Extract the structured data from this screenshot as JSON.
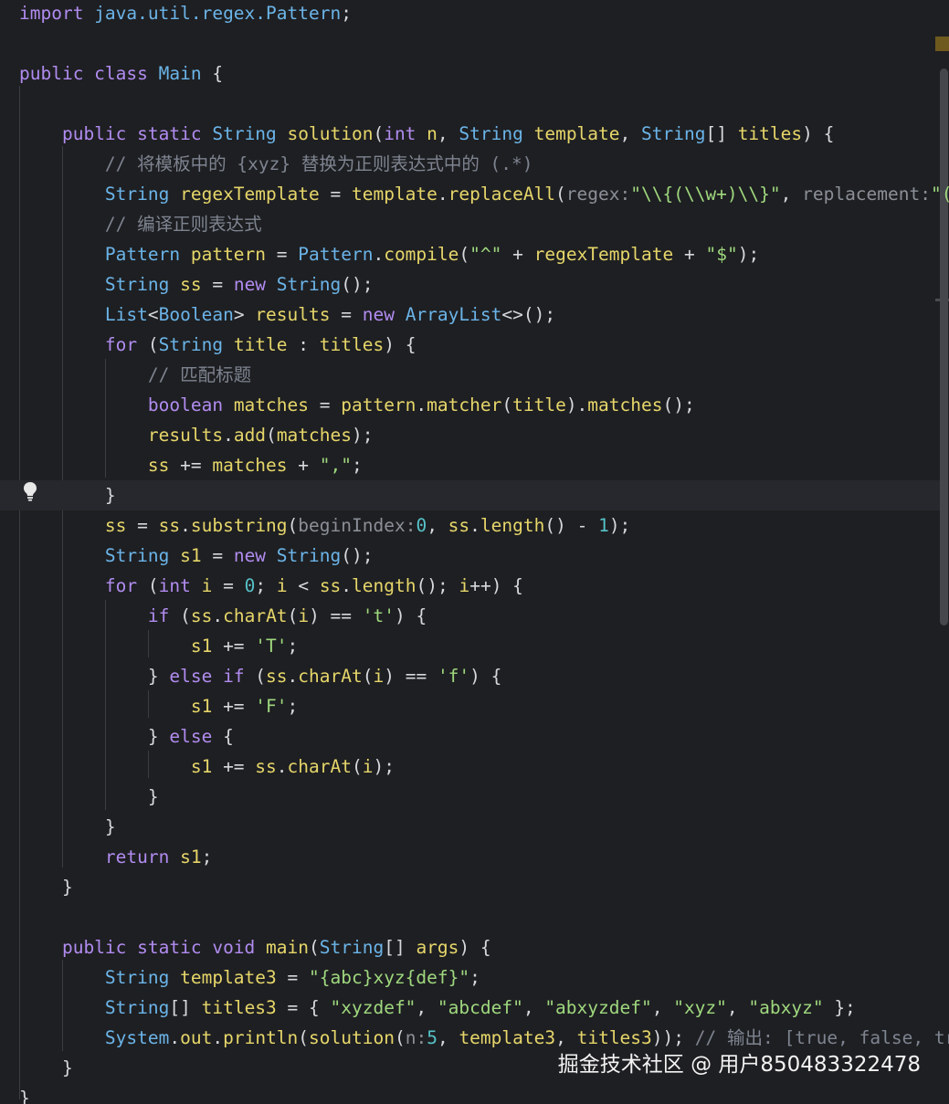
{
  "editor": {
    "language": "Java",
    "highlighted_line": 17,
    "lines": [
      [
        [
          "kw",
          "import "
        ],
        [
          "ty",
          "java.util.regex.Pattern"
        ],
        [
          "pl",
          ";"
        ]
      ],
      [],
      [
        [
          "kw",
          "public class "
        ],
        [
          "ty",
          "Main"
        ],
        [
          "pl",
          " {"
        ]
      ],
      [],
      [
        [
          "pl",
          "    "
        ],
        [
          "kw",
          "public static "
        ],
        [
          "ty",
          "String "
        ],
        [
          "fn",
          "solution"
        ],
        [
          "pl",
          "("
        ],
        [
          "kw",
          "int "
        ],
        [
          "va",
          "n"
        ],
        [
          "pl",
          ", "
        ],
        [
          "ty",
          "String "
        ],
        [
          "va",
          "template"
        ],
        [
          "pl",
          ", "
        ],
        [
          "ty",
          "String"
        ],
        [
          "pl",
          "[] "
        ],
        [
          "va",
          "titles"
        ],
        [
          "pl",
          ") {"
        ]
      ],
      [
        [
          "pl",
          "        "
        ],
        [
          "cm",
          "// 将模板中的 {xyz} 替换为正则表达式中的 (.*)"
        ]
      ],
      [
        [
          "pl",
          "        "
        ],
        [
          "ty",
          "String "
        ],
        [
          "va",
          "regexTemplate"
        ],
        [
          "pl",
          " = "
        ],
        [
          "va",
          "template"
        ],
        [
          "pl",
          "."
        ],
        [
          "fn",
          "replaceAll"
        ],
        [
          "pl",
          "("
        ],
        [
          "pm",
          "regex:"
        ],
        [
          "st",
          "\"\\\\{(\\\\w+)\\\\}\""
        ],
        [
          "pl",
          ", "
        ],
        [
          "pm",
          "replacement:"
        ],
        [
          "st",
          "\"(.*)\""
        ],
        [
          "pl",
          ");"
        ]
      ],
      [
        [
          "pl",
          "        "
        ],
        [
          "cm",
          "// 编译正则表达式"
        ]
      ],
      [
        [
          "pl",
          "        "
        ],
        [
          "ty",
          "Pattern "
        ],
        [
          "va",
          "pattern"
        ],
        [
          "pl",
          " = "
        ],
        [
          "ty",
          "Pattern"
        ],
        [
          "pl",
          "."
        ],
        [
          "fn",
          "compile"
        ],
        [
          "pl",
          "("
        ],
        [
          "st",
          "\"^\""
        ],
        [
          "pl",
          " + "
        ],
        [
          "va",
          "regexTemplate"
        ],
        [
          "pl",
          " + "
        ],
        [
          "st",
          "\"$\""
        ],
        [
          "pl",
          ");"
        ]
      ],
      [
        [
          "pl",
          "        "
        ],
        [
          "ty",
          "String "
        ],
        [
          "va",
          "ss"
        ],
        [
          "pl",
          " = "
        ],
        [
          "kw",
          "new "
        ],
        [
          "ty",
          "String"
        ],
        [
          "pl",
          "();"
        ]
      ],
      [
        [
          "pl",
          "        "
        ],
        [
          "ty",
          "List"
        ],
        [
          "pl",
          "<"
        ],
        [
          "ty",
          "Boolean"
        ],
        [
          "pl",
          "> "
        ],
        [
          "va",
          "results"
        ],
        [
          "pl",
          " = "
        ],
        [
          "kw",
          "new "
        ],
        [
          "ty",
          "ArrayList"
        ],
        [
          "pl",
          "<>();"
        ]
      ],
      [
        [
          "pl",
          "        "
        ],
        [
          "kw",
          "for "
        ],
        [
          "pl",
          "("
        ],
        [
          "ty",
          "String "
        ],
        [
          "va",
          "title"
        ],
        [
          "pl",
          " : "
        ],
        [
          "va",
          "titles"
        ],
        [
          "pl",
          ") {"
        ]
      ],
      [
        [
          "pl",
          "            "
        ],
        [
          "cm",
          "// 匹配标题"
        ]
      ],
      [
        [
          "pl",
          "            "
        ],
        [
          "kw",
          "boolean "
        ],
        [
          "va",
          "matches"
        ],
        [
          "pl",
          " = "
        ],
        [
          "va",
          "pattern"
        ],
        [
          "pl",
          "."
        ],
        [
          "fn",
          "matcher"
        ],
        [
          "pl",
          "("
        ],
        [
          "va",
          "title"
        ],
        [
          "pl",
          ")."
        ],
        [
          "fn",
          "matches"
        ],
        [
          "pl",
          "();"
        ]
      ],
      [
        [
          "pl",
          "            "
        ],
        [
          "va",
          "results"
        ],
        [
          "pl",
          "."
        ],
        [
          "fn",
          "add"
        ],
        [
          "pl",
          "("
        ],
        [
          "va",
          "matches"
        ],
        [
          "pl",
          ");"
        ]
      ],
      [
        [
          "pl",
          "            "
        ],
        [
          "va",
          "ss"
        ],
        [
          "pl",
          " += "
        ],
        [
          "va",
          "matches"
        ],
        [
          "pl",
          " + "
        ],
        [
          "st",
          "\",\""
        ],
        [
          "pl",
          ";"
        ]
      ],
      [
        [
          "pl",
          "        }"
        ]
      ],
      [
        [
          "pl",
          "        "
        ],
        [
          "va",
          "ss"
        ],
        [
          "pl",
          " = "
        ],
        [
          "va",
          "ss"
        ],
        [
          "pl",
          "."
        ],
        [
          "fn",
          "substring"
        ],
        [
          "pl",
          "("
        ],
        [
          "pm",
          "beginIndex:"
        ],
        [
          "nu",
          "0"
        ],
        [
          "pl",
          ", "
        ],
        [
          "va",
          "ss"
        ],
        [
          "pl",
          "."
        ],
        [
          "fn",
          "length"
        ],
        [
          "pl",
          "() - "
        ],
        [
          "nu",
          "1"
        ],
        [
          "pl",
          ");"
        ]
      ],
      [
        [
          "pl",
          "        "
        ],
        [
          "ty",
          "String "
        ],
        [
          "va",
          "s1"
        ],
        [
          "pl",
          " = "
        ],
        [
          "kw",
          "new "
        ],
        [
          "ty",
          "String"
        ],
        [
          "pl",
          "();"
        ]
      ],
      [
        [
          "pl",
          "        "
        ],
        [
          "kw",
          "for "
        ],
        [
          "pl",
          "("
        ],
        [
          "kw",
          "int "
        ],
        [
          "va",
          "i"
        ],
        [
          "pl",
          " = "
        ],
        [
          "nu",
          "0"
        ],
        [
          "pl",
          "; "
        ],
        [
          "va",
          "i"
        ],
        [
          "pl",
          " < "
        ],
        [
          "va",
          "ss"
        ],
        [
          "pl",
          "."
        ],
        [
          "fn",
          "length"
        ],
        [
          "pl",
          "(); "
        ],
        [
          "va",
          "i"
        ],
        [
          "pl",
          "++) {"
        ]
      ],
      [
        [
          "pl",
          "            "
        ],
        [
          "kw",
          "if "
        ],
        [
          "pl",
          "("
        ],
        [
          "va",
          "ss"
        ],
        [
          "pl",
          "."
        ],
        [
          "fn",
          "charAt"
        ],
        [
          "pl",
          "("
        ],
        [
          "va",
          "i"
        ],
        [
          "pl",
          ") == "
        ],
        [
          "st",
          "'t'"
        ],
        [
          "pl",
          ") {"
        ]
      ],
      [
        [
          "pl",
          "                "
        ],
        [
          "va",
          "s1"
        ],
        [
          "pl",
          " += "
        ],
        [
          "st",
          "'T'"
        ],
        [
          "pl",
          ";"
        ]
      ],
      [
        [
          "pl",
          "            } "
        ],
        [
          "kw",
          "else if "
        ],
        [
          "pl",
          "("
        ],
        [
          "va",
          "ss"
        ],
        [
          "pl",
          "."
        ],
        [
          "fn",
          "charAt"
        ],
        [
          "pl",
          "("
        ],
        [
          "va",
          "i"
        ],
        [
          "pl",
          ") == "
        ],
        [
          "st",
          "'f'"
        ],
        [
          "pl",
          ") {"
        ]
      ],
      [
        [
          "pl",
          "                "
        ],
        [
          "va",
          "s1"
        ],
        [
          "pl",
          " += "
        ],
        [
          "st",
          "'F'"
        ],
        [
          "pl",
          ";"
        ]
      ],
      [
        [
          "pl",
          "            } "
        ],
        [
          "kw",
          "else "
        ],
        [
          "pl",
          "{"
        ]
      ],
      [
        [
          "pl",
          "                "
        ],
        [
          "va",
          "s1"
        ],
        [
          "pl",
          " += "
        ],
        [
          "va",
          "ss"
        ],
        [
          "pl",
          "."
        ],
        [
          "fn",
          "charAt"
        ],
        [
          "pl",
          "("
        ],
        [
          "va",
          "i"
        ],
        [
          "pl",
          ");"
        ]
      ],
      [
        [
          "pl",
          "            }"
        ]
      ],
      [
        [
          "pl",
          "        }"
        ]
      ],
      [
        [
          "pl",
          "        "
        ],
        [
          "kw",
          "return "
        ],
        [
          "va",
          "s1"
        ],
        [
          "pl",
          ";"
        ]
      ],
      [
        [
          "pl",
          "    }"
        ]
      ],
      [],
      [
        [
          "pl",
          "    "
        ],
        [
          "kw",
          "public static void "
        ],
        [
          "fn",
          "main"
        ],
        [
          "pl",
          "("
        ],
        [
          "ty",
          "String"
        ],
        [
          "pl",
          "[] "
        ],
        [
          "va",
          "args"
        ],
        [
          "pl",
          ") {"
        ]
      ],
      [
        [
          "pl",
          "        "
        ],
        [
          "ty",
          "String "
        ],
        [
          "va",
          "template3"
        ],
        [
          "pl",
          " = "
        ],
        [
          "st",
          "\"{abc}xyz{def}\""
        ],
        [
          "pl",
          ";"
        ]
      ],
      [
        [
          "pl",
          "        "
        ],
        [
          "ty",
          "String"
        ],
        [
          "pl",
          "[] "
        ],
        [
          "va",
          "titles3"
        ],
        [
          "pl",
          " = { "
        ],
        [
          "st",
          "\"xyzdef\""
        ],
        [
          "pl",
          ", "
        ],
        [
          "st",
          "\"abcdef\""
        ],
        [
          "pl",
          ", "
        ],
        [
          "st",
          "\"abxyzdef\""
        ],
        [
          "pl",
          ", "
        ],
        [
          "st",
          "\"xyz\""
        ],
        [
          "pl",
          ", "
        ],
        [
          "st",
          "\"abxyz\""
        ],
        [
          "pl",
          " };"
        ]
      ],
      [
        [
          "pl",
          "        "
        ],
        [
          "ty",
          "System"
        ],
        [
          "pl",
          "."
        ],
        [
          "va",
          "out"
        ],
        [
          "pl",
          "."
        ],
        [
          "fn",
          "println"
        ],
        [
          "pl",
          "("
        ],
        [
          "fn",
          "solution"
        ],
        [
          "pl",
          "("
        ],
        [
          "pm",
          "n:"
        ],
        [
          "nu",
          "5"
        ],
        [
          "pl",
          ", "
        ],
        [
          "va",
          "template3"
        ],
        [
          "pl",
          ", "
        ],
        [
          "va",
          "titles3"
        ],
        [
          "pl",
          "));"
        ],
        [
          "cm",
          " // 输出: [true, false, true, false, false]"
        ]
      ],
      [
        [
          "pl",
          "    }"
        ]
      ],
      [
        [
          "pl",
          "}"
        ]
      ]
    ]
  },
  "gutter": {
    "intention_icon": "lightbulb-icon"
  },
  "watermark": {
    "text": "掘金技术社区 @ 用户850483322478"
  }
}
